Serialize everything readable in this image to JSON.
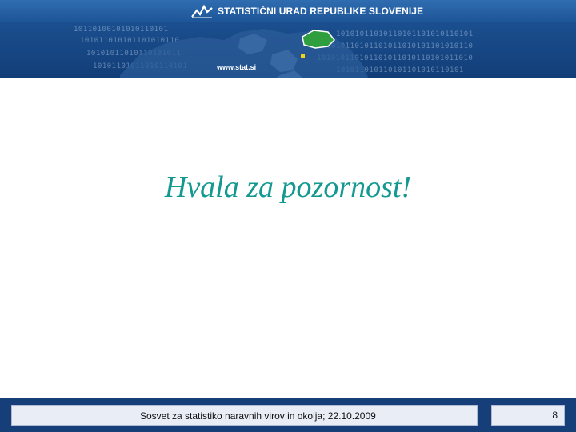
{
  "banner": {
    "title": "STATISTIČNI URAD REPUBLIKE SLOVENIJE",
    "url": "www.stat.si",
    "logo_icon": "sors-chart-logo-icon",
    "map_icon": "europe-map-icon",
    "binary_rows": [
      "10110100101010110101",
      "101011010101101010110",
      "10101011010110101011",
      "10101101011010110101",
      "10101011010110101101010110101",
      "1010110101101011010101101010110",
      "101010110101101011010110101011010",
      "101011010110101101010110101"
    ],
    "colors": {
      "banner": "#16488a",
      "highlight_country": "#2e9e3e"
    }
  },
  "slide": {
    "title": "Hvala za pozornost!",
    "title_color": "#13998f"
  },
  "footer": {
    "text": "Sosvet za statistiko naravnih virov in okolja; 22.10.2009",
    "page_number": "8",
    "color": "#163f7a"
  }
}
